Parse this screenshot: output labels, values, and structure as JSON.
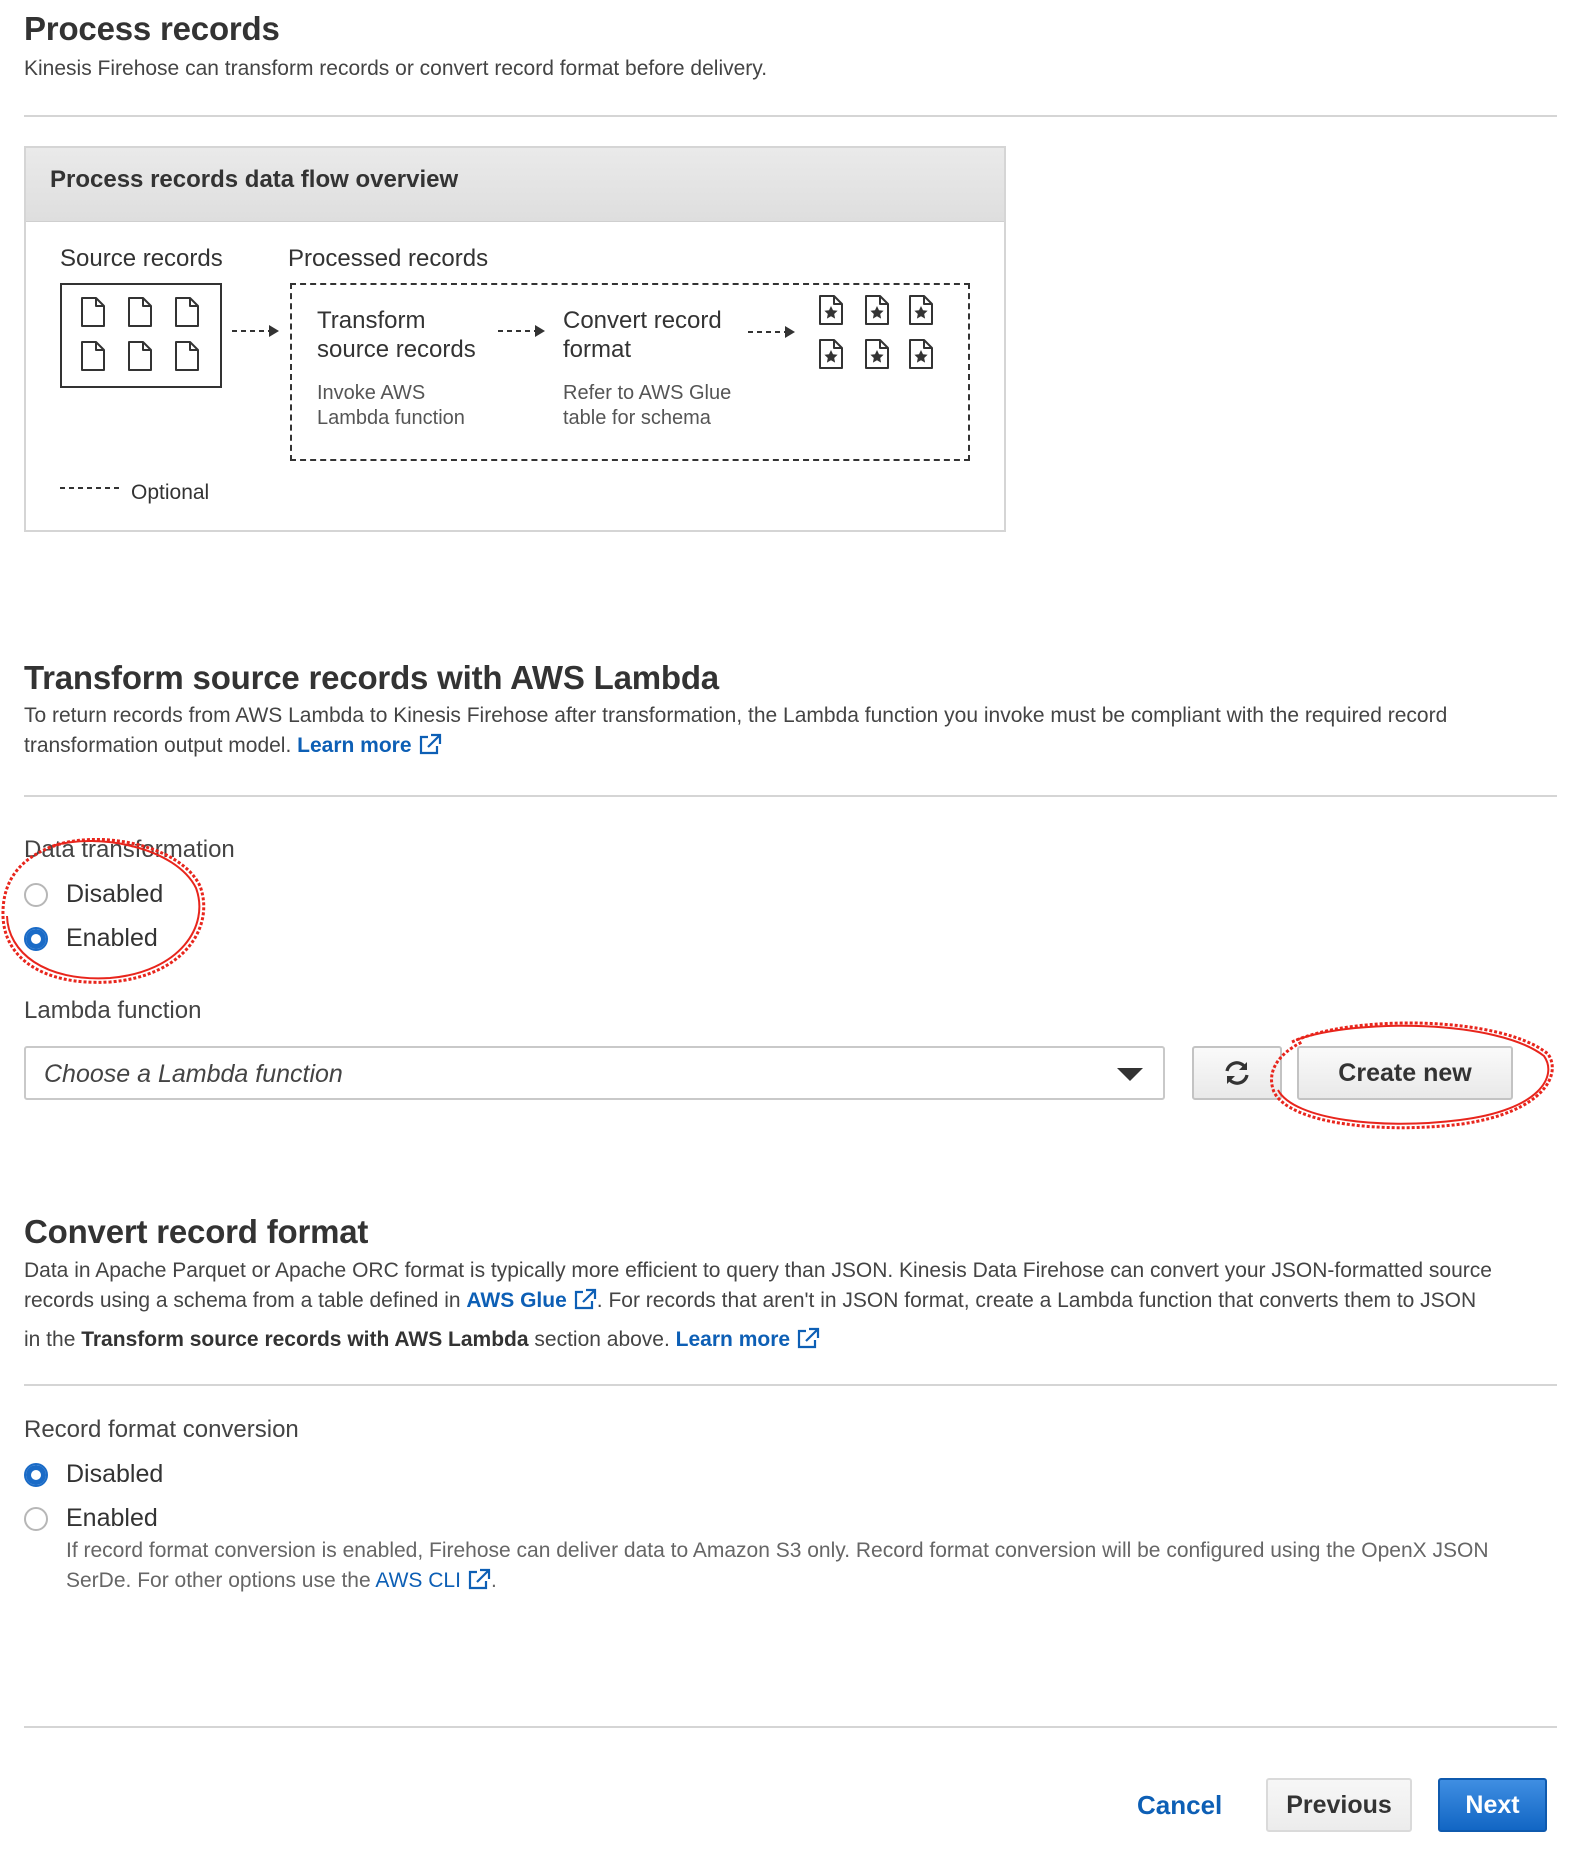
{
  "process": {
    "title": "Process records",
    "subtitle": "Kinesis Firehose can transform records or convert record format before delivery."
  },
  "overview": {
    "header": "Process records data flow overview",
    "source_label": "Source records",
    "processed_label": "Processed records",
    "transform_title_line1": "Transform",
    "transform_title_line2": "source records",
    "transform_sub_line1": "Invoke AWS",
    "transform_sub_line2": "Lambda function",
    "convert_title_line1": "Convert record",
    "convert_title_line2": "format",
    "convert_sub_line1": "Refer to AWS Glue",
    "convert_sub_line2": "table for schema",
    "optional_label": "Optional"
  },
  "lambda_section": {
    "title": "Transform source records with AWS Lambda",
    "desc_line1": "To return records from AWS Lambda to Kinesis Firehose after transformation, the Lambda function you invoke must be compliant with the required record",
    "desc_line2": "transformation output model.",
    "learn_more": "Learn more",
    "data_transformation_label": "Data transformation",
    "option_disabled": "Disabled",
    "option_enabled": "Enabled",
    "selected": "Enabled",
    "lambda_function_label": "Lambda function",
    "lambda_select_placeholder": "Choose a Lambda function",
    "create_new": "Create new"
  },
  "convert_section": {
    "title": "Convert record format",
    "desc_line1": "Data in Apache Parquet or Apache ORC format is typically more efficient to query than JSON. Kinesis Data Firehose can convert your JSON-formatted source",
    "desc_line2_a": "records using a schema from a table defined in",
    "aws_glue": "AWS Glue",
    "desc_line2_b": ". For records that aren't in JSON format, create a Lambda function that converts them to JSON",
    "desc_line3_a": "in the",
    "desc_line3_bold": "Transform source records with AWS Lambda",
    "desc_line3_b": "section above.",
    "learn_more": "Learn more",
    "record_format_label": "Record format conversion",
    "option_disabled": "Disabled",
    "option_enabled": "Enabled",
    "selected": "Disabled",
    "note_line1": "If record format conversion is enabled, Firehose can deliver data to Amazon S3 only. Record format conversion will be configured using the OpenX JSON",
    "note_line2_a": "SerDe. For other options use the",
    "aws_cli": "AWS CLI",
    "note_line2_b": "."
  },
  "footer": {
    "cancel": "Cancel",
    "previous": "Previous",
    "next": "Next"
  },
  "colors": {
    "accent": "#1a6bc7",
    "link": "#0d5fb5",
    "annotation": "#e8251c"
  }
}
